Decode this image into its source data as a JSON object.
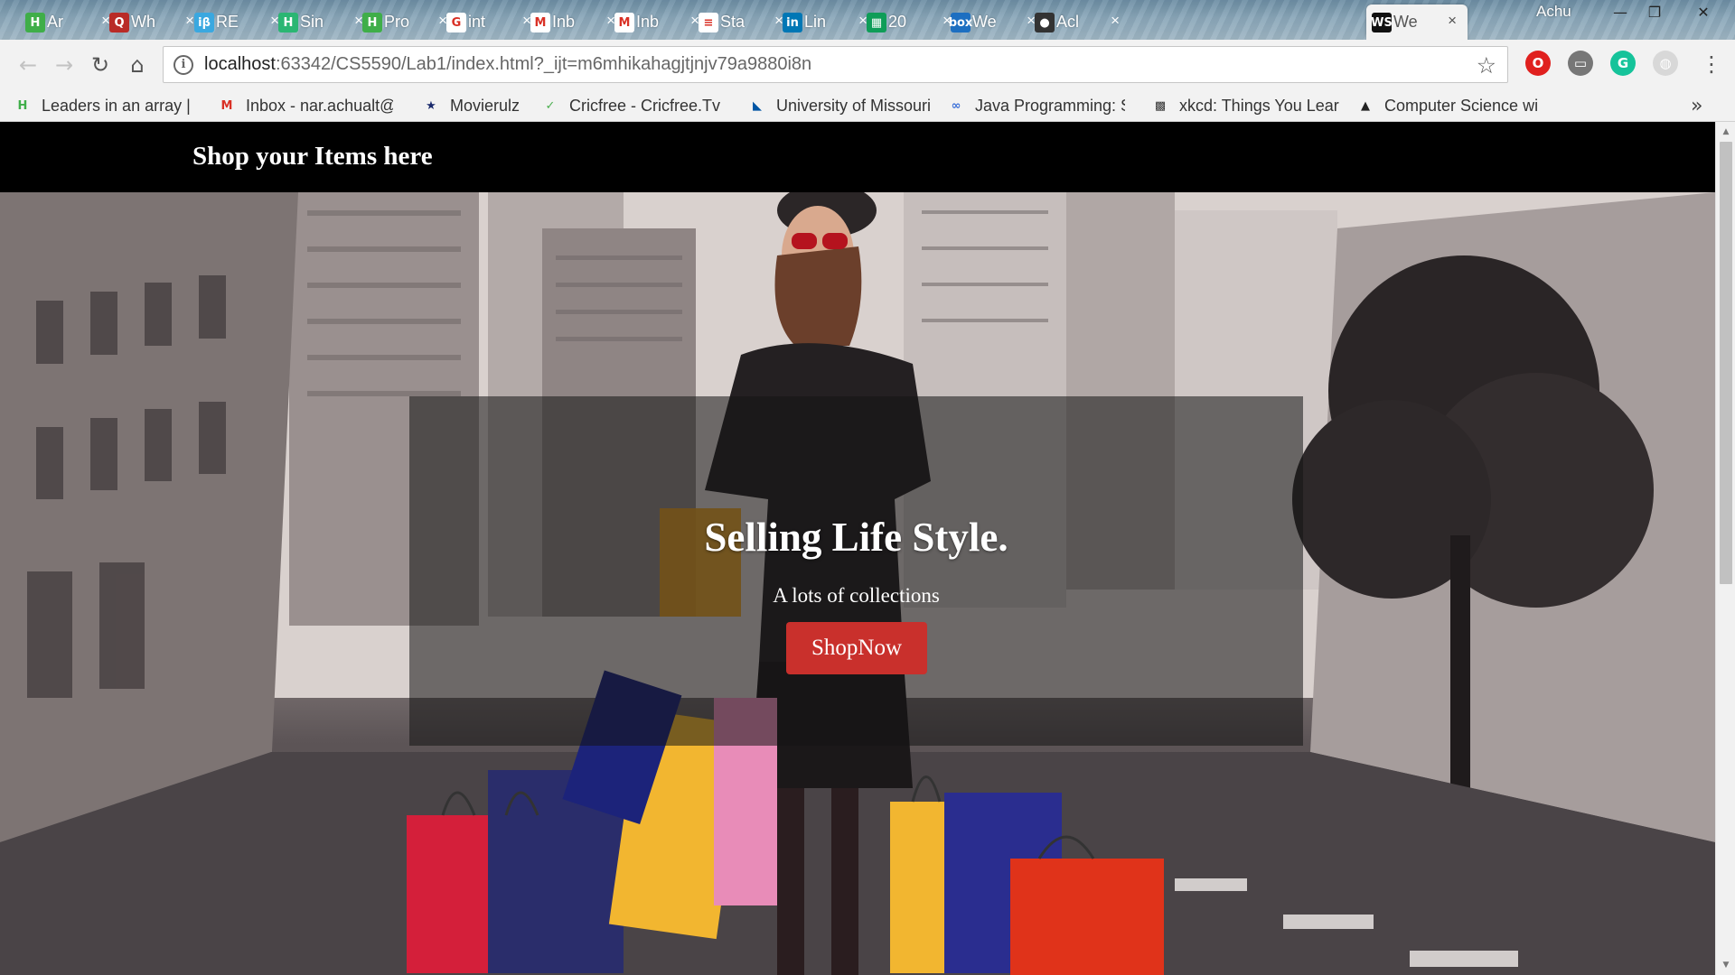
{
  "browser": {
    "tabs": [
      {
        "title": "Ar",
        "icon": "hackerrank-icon",
        "color": "#3fae49",
        "glyph": "H"
      },
      {
        "title": "Wh",
        "icon": "quora-icon",
        "color": "#b92b27",
        "glyph": "Q"
      },
      {
        "title": "RE",
        "icon": "interviewbit-icon",
        "color": "#3aa8e0",
        "glyph": "iβ"
      },
      {
        "title": "Sin",
        "icon": "hackerearth-icon",
        "color": "#2bb673",
        "glyph": "H"
      },
      {
        "title": "Pro",
        "icon": "hackerrank-icon",
        "color": "#3fae49",
        "glyph": "H"
      },
      {
        "title": "int",
        "icon": "google-icon",
        "color": "#ffffff",
        "glyph": "G"
      },
      {
        "title": "Inb",
        "icon": "gmail-icon",
        "color": "#ffffff",
        "glyph": "M"
      },
      {
        "title": "Inb",
        "icon": "gmail-icon",
        "color": "#ffffff",
        "glyph": "M"
      },
      {
        "title": "Sta",
        "icon": "stack-icon",
        "color": "#ffffff",
        "glyph": "≡"
      },
      {
        "title": "Lin",
        "icon": "linkedin-icon",
        "color": "#0077b5",
        "glyph": "in"
      },
      {
        "title": "20",
        "icon": "sheets-icon",
        "color": "#0f9d58",
        "glyph": "▦"
      },
      {
        "title": "We",
        "icon": "box-icon",
        "color": "#1d6fc1",
        "glyph": "box"
      },
      {
        "title": "Acl",
        "icon": "github-icon",
        "color": "#333333",
        "glyph": "●"
      },
      {
        "title": "We",
        "icon": "webstorm-icon",
        "color": "#111111",
        "glyph": "WS"
      }
    ],
    "close_glyph": "×",
    "profile_name": "Achu",
    "window_controls": {
      "minimize": "—",
      "restore": "❐",
      "close": "✕"
    },
    "toolbar": {
      "back": "←",
      "forward": "→",
      "reload": "↻",
      "home": "⌂",
      "info_glyph": "i",
      "url_host": "localhost",
      "url_rest": ":63342/CS5590/Lab1/index.html?_ijt=m6mhikahagjtjnjv79a9880i8n",
      "star": "☆",
      "menu": "⋮"
    },
    "extensions": [
      {
        "name": "opera-icon",
        "color": "#e0201e",
        "glyph": "O"
      },
      {
        "name": "cast-icon",
        "color": "#777777",
        "glyph": "▭"
      },
      {
        "name": "grammarly-icon",
        "color": "#15c39a",
        "glyph": "G"
      },
      {
        "name": "extension-icon",
        "color": "#d8d8d8",
        "glyph": "◍"
      }
    ],
    "bookmarks": [
      {
        "label": "Leaders in an array | G",
        "icon": "hackerrank-icon",
        "color": "#3fae49",
        "glyph": "H"
      },
      {
        "label": "Inbox - nar.achualt@g",
        "icon": "gmail-icon",
        "color": "#d93025",
        "glyph": "M"
      },
      {
        "label": "Movierulz",
        "icon": "movierulz-icon",
        "color": "#1a2a6c",
        "glyph": "★"
      },
      {
        "label": "Cricfree - Cricfree.Tv",
        "icon": "cricfree-icon",
        "color": "#4caf50",
        "glyph": "✓"
      },
      {
        "label": "University of Missouri",
        "icon": "umkc-icon",
        "color": "#0055a4",
        "glyph": "◣"
      },
      {
        "label": "Java Programming: S",
        "icon": "java-icon",
        "color": "#3a6fd8",
        "glyph": "∞"
      },
      {
        "label": "xkcd: Things You Lear",
        "icon": "xkcd-icon",
        "color": "#333333",
        "glyph": "▩"
      },
      {
        "label": "Computer Science wi",
        "icon": "grad-cap-icon",
        "color": "#222222",
        "glyph": "▲"
      }
    ],
    "bookmarks_more": "»"
  },
  "site": {
    "title": "Shop your Items here",
    "hero": {
      "heading": "Selling Life Style.",
      "subheading": "A lots of collections",
      "button_label": "ShopNow"
    },
    "colors": {
      "button": "#c9302c",
      "header_bg": "#000000"
    }
  },
  "scrollbar": {
    "up": "▲",
    "down": "▼"
  }
}
